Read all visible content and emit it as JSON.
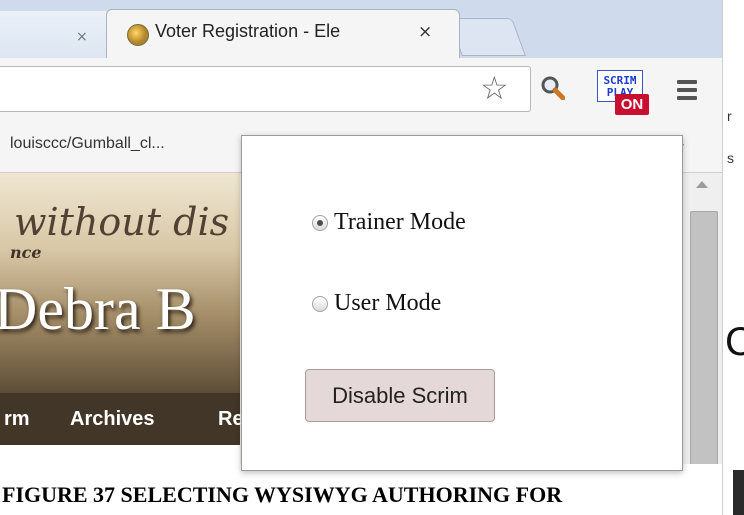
{
  "tabs": {
    "previous": {
      "close_icon": "×"
    },
    "active": {
      "title": "Voter Registration - Ele",
      "close_icon": "×",
      "favicon": "globe-seal-icon"
    }
  },
  "toolbar": {
    "star_icon": "☆",
    "extension": {
      "label": "SCRIM PLAY",
      "badge": "ON"
    }
  },
  "bookmarks": {
    "item": "louisccc/Gumball_cl...",
    "overflow": "»"
  },
  "page": {
    "tagline": "without dis",
    "subline": "nce",
    "name": "Debra B",
    "nav": [
      "rm",
      "Archives",
      "Re"
    ]
  },
  "popup": {
    "trainer_label": "Trainer Mode",
    "user_label": "User Mode",
    "selected": "Trainer Mode",
    "disable_button": "Disable Scrim"
  },
  "caption": "FIGURE 37 SELECTING WYSIWYG AUTHORING FOR",
  "right_fragments": {
    "a": "r",
    "b": "s",
    "big": "C"
  }
}
